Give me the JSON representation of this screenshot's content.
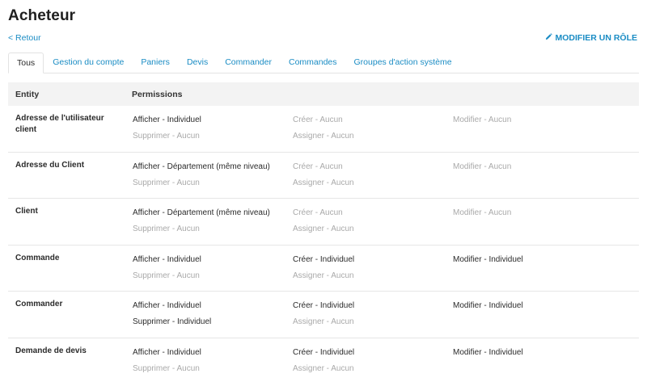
{
  "header": {
    "title": "Acheteur",
    "back_label": "< Retour",
    "edit_label": "MODIFIER UN RÔLE",
    "edit_icon": "pencil-icon"
  },
  "tabs": [
    {
      "label": "Tous",
      "active": true
    },
    {
      "label": "Gestion du compte",
      "active": false
    },
    {
      "label": "Paniers",
      "active": false
    },
    {
      "label": "Devis",
      "active": false
    },
    {
      "label": "Commander",
      "active": false
    },
    {
      "label": "Commandes",
      "active": false
    },
    {
      "label": "Groupes d'action système",
      "active": false
    }
  ],
  "table": {
    "columns": [
      "Entity",
      "Permissions"
    ],
    "rows": [
      {
        "entity": "Adresse de l'utilisateur client",
        "perms": [
          {
            "label": "Afficher - Individuel",
            "granted": true
          },
          {
            "label": "Créer - Aucun",
            "granted": false
          },
          {
            "label": "Modifier - Aucun",
            "granted": false
          },
          {
            "label": "Supprimer - Aucun",
            "granted": false
          },
          {
            "label": "Assigner - Aucun",
            "granted": false
          }
        ]
      },
      {
        "entity": "Adresse du Client",
        "perms": [
          {
            "label": "Afficher - Département (même niveau)",
            "granted": true
          },
          {
            "label": "Créer - Aucun",
            "granted": false
          },
          {
            "label": "Modifier - Aucun",
            "granted": false
          },
          {
            "label": "Supprimer - Aucun",
            "granted": false
          },
          {
            "label": "Assigner - Aucun",
            "granted": false
          }
        ]
      },
      {
        "entity": "Client",
        "perms": [
          {
            "label": "Afficher - Département (même niveau)",
            "granted": true
          },
          {
            "label": "Créer - Aucun",
            "granted": false
          },
          {
            "label": "Modifier - Aucun",
            "granted": false
          },
          {
            "label": "Supprimer - Aucun",
            "granted": false
          },
          {
            "label": "Assigner - Aucun",
            "granted": false
          }
        ]
      },
      {
        "entity": "Commande",
        "perms": [
          {
            "label": "Afficher - Individuel",
            "granted": true
          },
          {
            "label": "Créer - Individuel",
            "granted": true
          },
          {
            "label": "Modifier - Individuel",
            "granted": true
          },
          {
            "label": "Supprimer - Aucun",
            "granted": false
          },
          {
            "label": "Assigner - Aucun",
            "granted": false
          }
        ]
      },
      {
        "entity": "Commander",
        "perms": [
          {
            "label": "Afficher - Individuel",
            "granted": true
          },
          {
            "label": "Créer - Individuel",
            "granted": true
          },
          {
            "label": "Modifier - Individuel",
            "granted": true
          },
          {
            "label": "Supprimer - Individuel",
            "granted": true
          },
          {
            "label": "Assigner - Aucun",
            "granted": false
          }
        ]
      },
      {
        "entity": "Demande de devis",
        "perms": [
          {
            "label": "Afficher - Individuel",
            "granted": true
          },
          {
            "label": "Créer - Individuel",
            "granted": true
          },
          {
            "label": "Modifier - Individuel",
            "granted": true
          },
          {
            "label": "Supprimer - Aucun",
            "granted": false
          },
          {
            "label": "Assigner - Aucun",
            "granted": false
          }
        ]
      }
    ]
  },
  "colors": {
    "link": "#1a8cc4",
    "granted": "#2b2b2b",
    "none": "#a9a9a9",
    "header_bg": "#f3f3f3"
  }
}
